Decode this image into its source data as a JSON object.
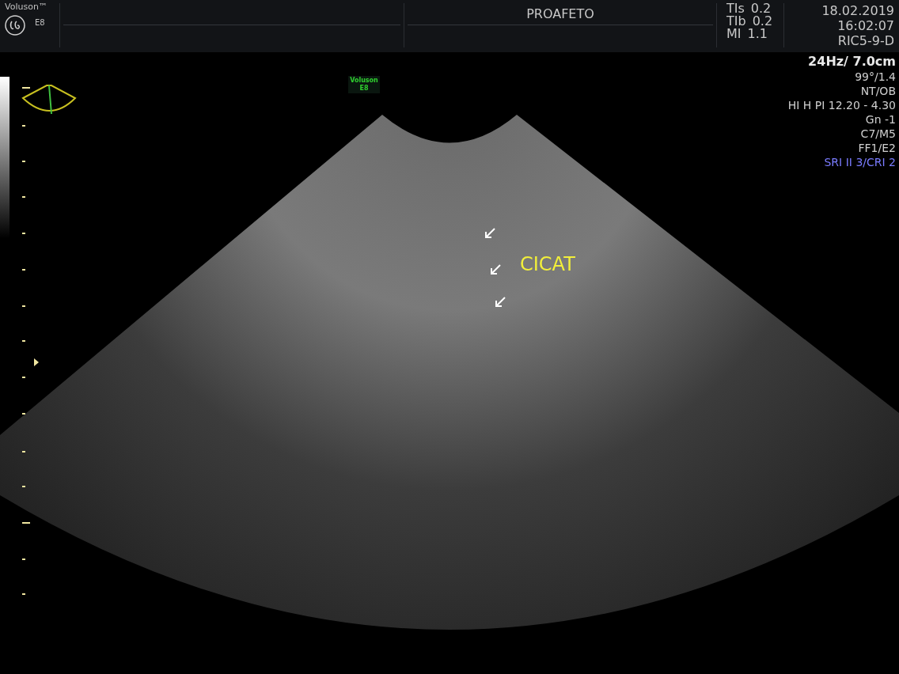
{
  "header": {
    "brand": "Voluson™",
    "model": "E8",
    "patient": "PROAFETO",
    "indices": [
      {
        "label": "TIs",
        "value": "0.2"
      },
      {
        "label": "TIb",
        "value": "0.2"
      },
      {
        "label": "MI",
        "value": "1.1"
      }
    ],
    "date": "18.02.2019",
    "time": "16:02:07",
    "probe": "RIC5-9-D"
  },
  "image_label": {
    "line1": "Voluson",
    "line2": "E8"
  },
  "settings": [
    {
      "text": "24Hz/ 7.0cm",
      "kind": "primary"
    },
    {
      "text": "99°/1.4",
      "kind": "normal"
    },
    {
      "text": "NT/OB",
      "kind": "normal"
    },
    {
      "text": "HI H PI 12.20 - 4.30",
      "kind": "normal"
    },
    {
      "text": "Gn  -1",
      "kind": "normal"
    },
    {
      "text": "C7/M5",
      "kind": "normal"
    },
    {
      "text": "FF1/E2",
      "kind": "normal"
    },
    {
      "text": "SRI II 3/CRI 2",
      "kind": "accent"
    }
  ],
  "annotation": {
    "text": "CICAT"
  }
}
